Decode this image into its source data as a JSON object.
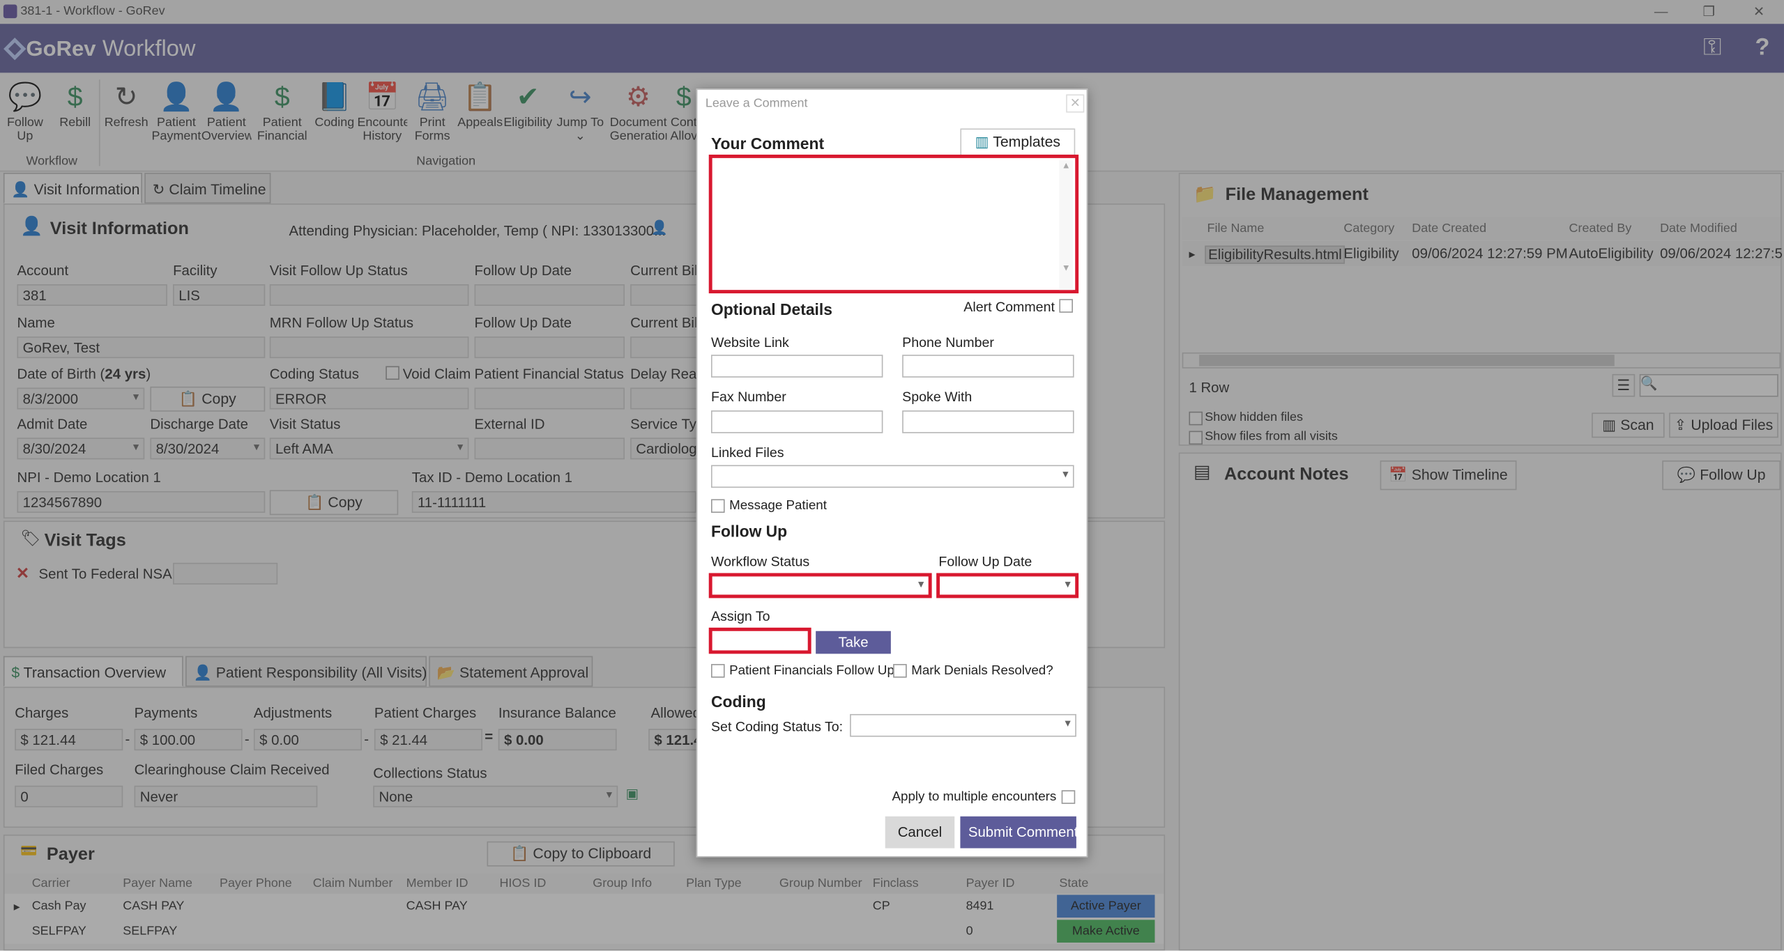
{
  "window": {
    "title": "381-1 - Workflow - GoRev",
    "buttons": [
      "—",
      "❐",
      "✕"
    ]
  },
  "header": {
    "logo": "GoRev",
    "title": "Workflow",
    "icons": [
      "person-key-icon",
      "help-icon"
    ],
    "help": "?",
    "keys": "⚿"
  },
  "ribbon": {
    "buttons": [
      {
        "label": "Follow Up",
        "icon": "💬",
        "color": "#3a7bc8"
      },
      {
        "label": "Rebill",
        "icon": "$",
        "color": "#2e8b57"
      },
      {
        "label": "Refresh",
        "icon": "↻",
        "color": "#444"
      },
      {
        "label": "Patient Payment",
        "icon": "👤",
        "color": "#2e8b57"
      },
      {
        "label": "Patient Overview",
        "icon": "👤",
        "color": "#2e8b57"
      },
      {
        "label": "Patient Financials",
        "icon": "$",
        "color": "#2e8b57"
      },
      {
        "label": "Coding",
        "icon": "📘",
        "color": "#3a7bc8"
      },
      {
        "label": "Encounter History",
        "icon": "📅",
        "color": "#444"
      },
      {
        "label": "Print Forms",
        "icon": "🖨",
        "color": "#3a7bc8"
      },
      {
        "label": "Appeals",
        "icon": "📋",
        "color": "#3a7bc8"
      },
      {
        "label": "Eligibility",
        "icon": "✔",
        "color": "#2e8b57"
      },
      {
        "label": "Jump To",
        "icon": "↪",
        "color": "#3a7bc8",
        "sub": "⌄"
      },
      {
        "label": "Document Generation",
        "icon": "⚙",
        "color": "#c05050"
      },
      {
        "label": "Cont Allov",
        "icon": "$",
        "color": "#2e8b57"
      }
    ],
    "groups": {
      "workflow": "Workflow",
      "navigation": "Navigation"
    }
  },
  "left": {
    "tabs": [
      "Visit Information",
      "Claim Timeline"
    ],
    "visit": {
      "heading": "Visit Information",
      "attending": "Attending Physician: Placeholder, Temp ( NPI: 133013300...",
      "labels": {
        "account": "Account",
        "facility": "Facility",
        "vfus": "Visit Follow Up Status",
        "fud": "Follow Up Date",
        "cbill": "Current Bill",
        "name": "Name",
        "mrnfus": "MRN Follow Up Status",
        "fud2": "Follow Up Date",
        "cbill2": "Current Bill",
        "dob": "Date of Birth (",
        "dobage": "24 yrs",
        "dobclose": ")",
        "coding": "Coding Status",
        "void": "Void Claim",
        "pfs": "Patient Financial Status",
        "delay": "Delay Reas",
        "admit": "Admit Date",
        "discharge": "Discharge Date",
        "vstatus": "Visit Status",
        "extid": "External ID",
        "stype": "Service Typ",
        "npi": "NPI - Demo Location 1",
        "tax": "Tax ID - Demo Location 1"
      },
      "values": {
        "account": "381",
        "facility": "LIS",
        "name": "GoRev, Test",
        "dob": "8/3/2000",
        "coding": "ERROR",
        "admit": "8/30/2024",
        "discharge": "8/30/2024",
        "vstatus": "Left AMA",
        "stype": "Cardiologi",
        "npi": "1234567890",
        "tax": "11-1111111"
      },
      "copy": "Copy"
    },
    "tags": {
      "heading": "Visit Tags",
      "item": "Sent To Federal NSA"
    },
    "tx": {
      "tabs": [
        "Transaction Overview",
        "Patient Responsibility (All Visits)",
        "Statement Approval"
      ],
      "labels": {
        "charges": "Charges",
        "payments": "Payments",
        "adjustments": "Adjustments",
        "pcharges": "Patient Charges",
        "insbal": "Insurance Balance",
        "allowed": "Allowed",
        "filed": "Filed Charges",
        "chreceived": "Clearinghouse Claim Received",
        "collections": "Collections Status"
      },
      "values": {
        "charges": "$ 121.44",
        "payments": "$ 100.00",
        "adjustments": "$ 0.00",
        "pcharges": "$ 21.44",
        "insbal": "$ 0.00",
        "allowed": "$ 121.4",
        "filed": "0",
        "chreceived": "Never",
        "collections": "None"
      },
      "ops": [
        "-",
        "-",
        "-",
        "="
      ]
    },
    "payer": {
      "heading": "Payer",
      "copy": "Copy to Clipboard",
      "columns": [
        "Carrier",
        "Payer Name",
        "Payer Phone",
        "Claim Number",
        "Member ID",
        "HIOS ID",
        "Group Info",
        "Plan Type",
        "Group Number",
        "Finclass",
        "Payer ID",
        "State"
      ],
      "rows": [
        [
          "Cash Pay",
          "CASH PAY",
          "",
          "",
          "CASH PAY",
          "",
          "",
          "",
          "",
          "CP",
          "8491",
          "Active Payer"
        ],
        [
          "SELFPAY",
          "SELFPAY",
          "",
          "",
          "",
          "",
          "",
          "",
          "",
          "",
          "0",
          "Make Active"
        ]
      ]
    }
  },
  "right": {
    "files": {
      "heading": "File Management",
      "columns": [
        "File Name",
        "Category",
        "Date Created",
        "Created By",
        "Date Modified"
      ],
      "row": [
        "EligibilityResults.html",
        "Eligibility",
        "09/06/2024 12:27:59 PM",
        "AutoEligibility",
        "09/06/2024 12:27:5"
      ],
      "count": "1 Row",
      "show_hidden": "Show hidden files",
      "show_all": "Show files from all visits",
      "scan": "Scan",
      "upload": "Upload Files"
    },
    "notes": {
      "heading": "Account Notes",
      "timeline": "Show Timeline",
      "followup": "Follow Up"
    }
  },
  "dialog": {
    "title": "Leave a Comment",
    "close": "✕",
    "your_comment": "Your Comment",
    "templates": "Templates",
    "optional": "Optional Details",
    "alert": "Alert Comment",
    "website": "Website Link",
    "phone": "Phone Number",
    "fax": "Fax Number",
    "spoke": "Spoke With",
    "linked": "Linked Files",
    "message": "Message Patient",
    "followup": "Follow Up",
    "wstatus": "Workflow Status",
    "fudate": "Follow Up Date",
    "assign": "Assign To",
    "take": "Take",
    "pfollow": "Patient Financials Follow Up",
    "mark": "Mark Denials Resolved?",
    "coding": "Coding",
    "setcoding": "Set Coding Status To:",
    "multi": "Apply to multiple encounters",
    "cancel": "Cancel",
    "submit": "Submit Comment",
    "colors": {
      "highlight": "#d8182f",
      "submit": "#5d5c9a",
      "take": "#5d5c9a"
    }
  }
}
